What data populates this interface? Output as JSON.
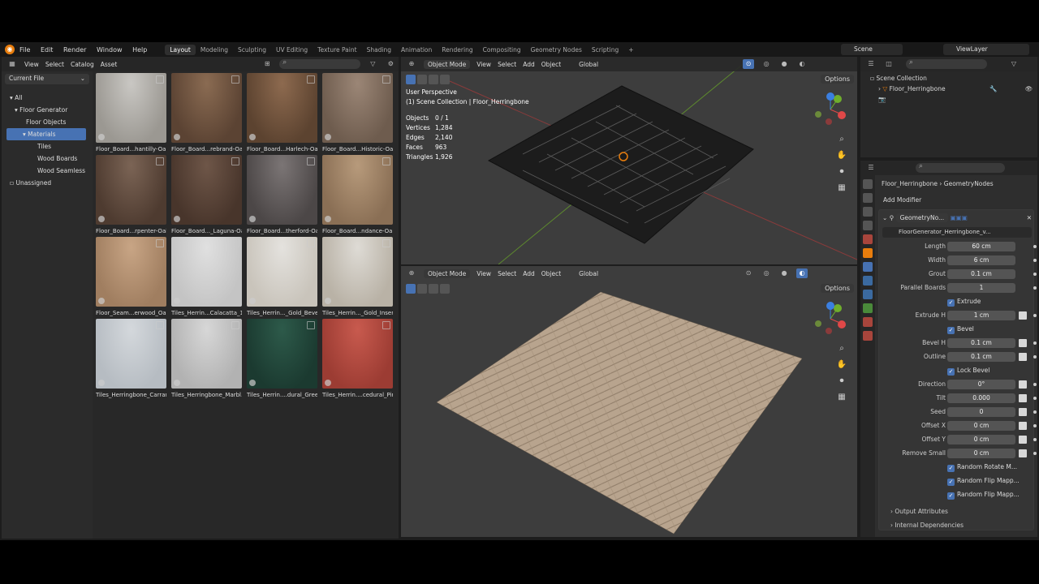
{
  "menubar": {
    "items": [
      "File",
      "Edit",
      "Render",
      "Window",
      "Help"
    ]
  },
  "workspaces": [
    "Layout",
    "Modeling",
    "Sculpting",
    "UV Editing",
    "Texture Paint",
    "Shading",
    "Animation",
    "Rendering",
    "Compositing",
    "Geometry Nodes",
    "Scripting"
  ],
  "workspace_add": "+",
  "scene": {
    "label": "Scene",
    "viewlayer": "ViewLayer"
  },
  "asset_browser": {
    "menus": [
      "View",
      "Select",
      "Catalog",
      "Asset"
    ],
    "library": "Current File",
    "tree": [
      "All",
      "Floor Generator",
      "Floor Objects",
      "Materials",
      "Tiles",
      "Wood Boards",
      "Wood Seamless",
      "Unassigned"
    ],
    "assets": [
      {
        "label": "Floor_Board...hantilly-Oak",
        "c1": "#c9c7c3",
        "c2": "#9b9892"
      },
      {
        "label": "Floor_Board...rebrand-Oak",
        "c1": "#8a6b52",
        "c2": "#5b4333"
      },
      {
        "label": "Floor_Board...Harlech-Oak",
        "c1": "#8d6a4f",
        "c2": "#5c4330"
      },
      {
        "label": "Floor_Board...Historic-Oak",
        "c1": "#9b8676",
        "c2": "#6e5c4e"
      },
      {
        "label": "Floor_Board...rpenter-Oak",
        "c1": "#7b6455",
        "c2": "#4e3b30"
      },
      {
        "label": "Floor_Board..._Laguna-Oak",
        "c1": "#6e5648",
        "c2": "#48352b"
      },
      {
        "label": "Floor_Board...therford-Oak",
        "c1": "#7b7575",
        "c2": "#4c4747"
      },
      {
        "label": "Floor_Board...ndance-Oak",
        "c1": "#b79a7b",
        "c2": "#8a6f55"
      },
      {
        "label": "Floor_Seam...erwood_Oak",
        "c1": "#c8a585",
        "c2": "#a07e60"
      },
      {
        "label": "Tiles_Herrin...Calacatta_1",
        "c1": "#e0e0e0",
        "c2": "#c4c4c4"
      },
      {
        "label": "Tiles_Herrin..._Gold_Bevel",
        "c1": "#e4e2de",
        "c2": "#c9c4bb"
      },
      {
        "label": "Tiles_Herrin..._Gold_Insert",
        "c1": "#dedbd5",
        "c2": "#b9b2a6"
      },
      {
        "label": "Tiles_Herringbone_Carrara",
        "c1": "#d4d8dc",
        "c2": "#b6bcc2"
      },
      {
        "label": "Tiles_Herringbone_Marbl...",
        "c1": "#d7d7d7",
        "c2": "#b2b2b2"
      },
      {
        "label": "Tiles_Herrin....dural_Green",
        "c1": "#2d5a4a",
        "c2": "#1b3a30"
      },
      {
        "label": "Tiles_Herrin....cedural_Pink",
        "c1": "#c85a4e",
        "c2": "#9c3c33"
      }
    ]
  },
  "viewport_top": {
    "mode": "Object Mode",
    "menus": [
      "View",
      "Select",
      "Add",
      "Object"
    ],
    "transform": "Global",
    "options": "Options",
    "perspective": "User Perspective",
    "collection": "(1) Scene Collection | Floor_Herringbone",
    "stats": [
      {
        "k": "Objects",
        "v": "0 / 1"
      },
      {
        "k": "Vertices",
        "v": "1,284"
      },
      {
        "k": "Edges",
        "v": "2,140"
      },
      {
        "k": "Faces",
        "v": "963"
      },
      {
        "k": "Triangles",
        "v": "1,926"
      }
    ]
  },
  "viewport_bottom": {
    "mode": "Object Mode",
    "menus": [
      "View",
      "Select",
      "Add",
      "Object"
    ],
    "transform": "Global",
    "options": "Options"
  },
  "outliner": {
    "root": "Scene Collection",
    "object": "Floor_Herringbone"
  },
  "properties": {
    "breadcrumb_object": "Floor_Herringbone",
    "breadcrumb_sep": "›",
    "breadcrumb_modifier": "GeometryNodes",
    "add_modifier": "Add Modifier",
    "modifier_name": "GeometryNo...",
    "node_group": "FloorGenerator_Herringbone_v...",
    "fields": [
      {
        "k": "Length",
        "v": "60 cm",
        "kf": false
      },
      {
        "k": "Width",
        "v": "6 cm",
        "kf": false
      },
      {
        "k": "Grout",
        "v": "0.1 cm",
        "kf": false
      },
      {
        "k": "Parallel Boards",
        "v": "1",
        "kf": false
      }
    ],
    "extrude": "Extrude",
    "extrude_h": {
      "k": "Extrude H",
      "v": "1 cm"
    },
    "bevel": "Bevel",
    "bevel_fields": [
      {
        "k": "Bevel H",
        "v": "0.1 cm"
      },
      {
        "k": "Outline",
        "v": "0.1 cm"
      }
    ],
    "lock_bevel": "Lock Bevel",
    "more_fields": [
      {
        "k": "Direction",
        "v": "0°"
      },
      {
        "k": "Tilt",
        "v": "0.000"
      },
      {
        "k": "Seed",
        "v": "0"
      },
      {
        "k": "Offset X",
        "v": "0 cm"
      },
      {
        "k": "Offset Y",
        "v": "0 cm"
      },
      {
        "k": "Remove Small",
        "v": "0 cm"
      }
    ],
    "checks": [
      "Random Rotate M...",
      "Random Flip Mapp...",
      "Random Flip Mapp..."
    ],
    "panels": [
      "Output Attributes",
      "Internal Dependencies"
    ]
  },
  "colors": {
    "accent": "#4772b3",
    "orange": "#e87d0d",
    "bg": "#1d1d1d"
  }
}
